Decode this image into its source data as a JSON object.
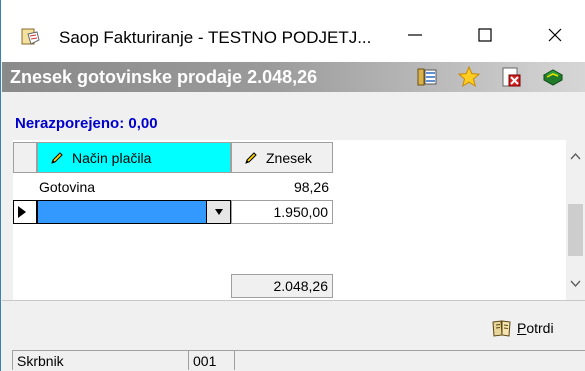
{
  "window": {
    "title": "Saop Fakturiranje - TESTNO PODJETJ...",
    "minimize": "—",
    "maximize": "☐",
    "close": "✕"
  },
  "header": {
    "title": "Znesek gotovinske prodaje 2.048,26",
    "icons": [
      "list-icon",
      "star-icon",
      "delete-doc-icon",
      "book-icon"
    ]
  },
  "unassigned": {
    "label": "Nerazporejeno: 0,00"
  },
  "grid": {
    "columns": [
      {
        "label": "Način plačila"
      },
      {
        "label": "Znesek"
      }
    ],
    "rows": [
      {
        "method": "Gotovina",
        "amount": "98,26"
      },
      {
        "method": "",
        "amount": "1.950,00"
      }
    ],
    "total": "2.048,26"
  },
  "actions": {
    "confirm_label_first": "P",
    "confirm_label_rest": "otrdi"
  },
  "status": {
    "user": "Skrbnik",
    "code": "001"
  },
  "colors": {
    "accent_header_cell": "#00ffff",
    "unassigned_text": "#0000cc"
  }
}
